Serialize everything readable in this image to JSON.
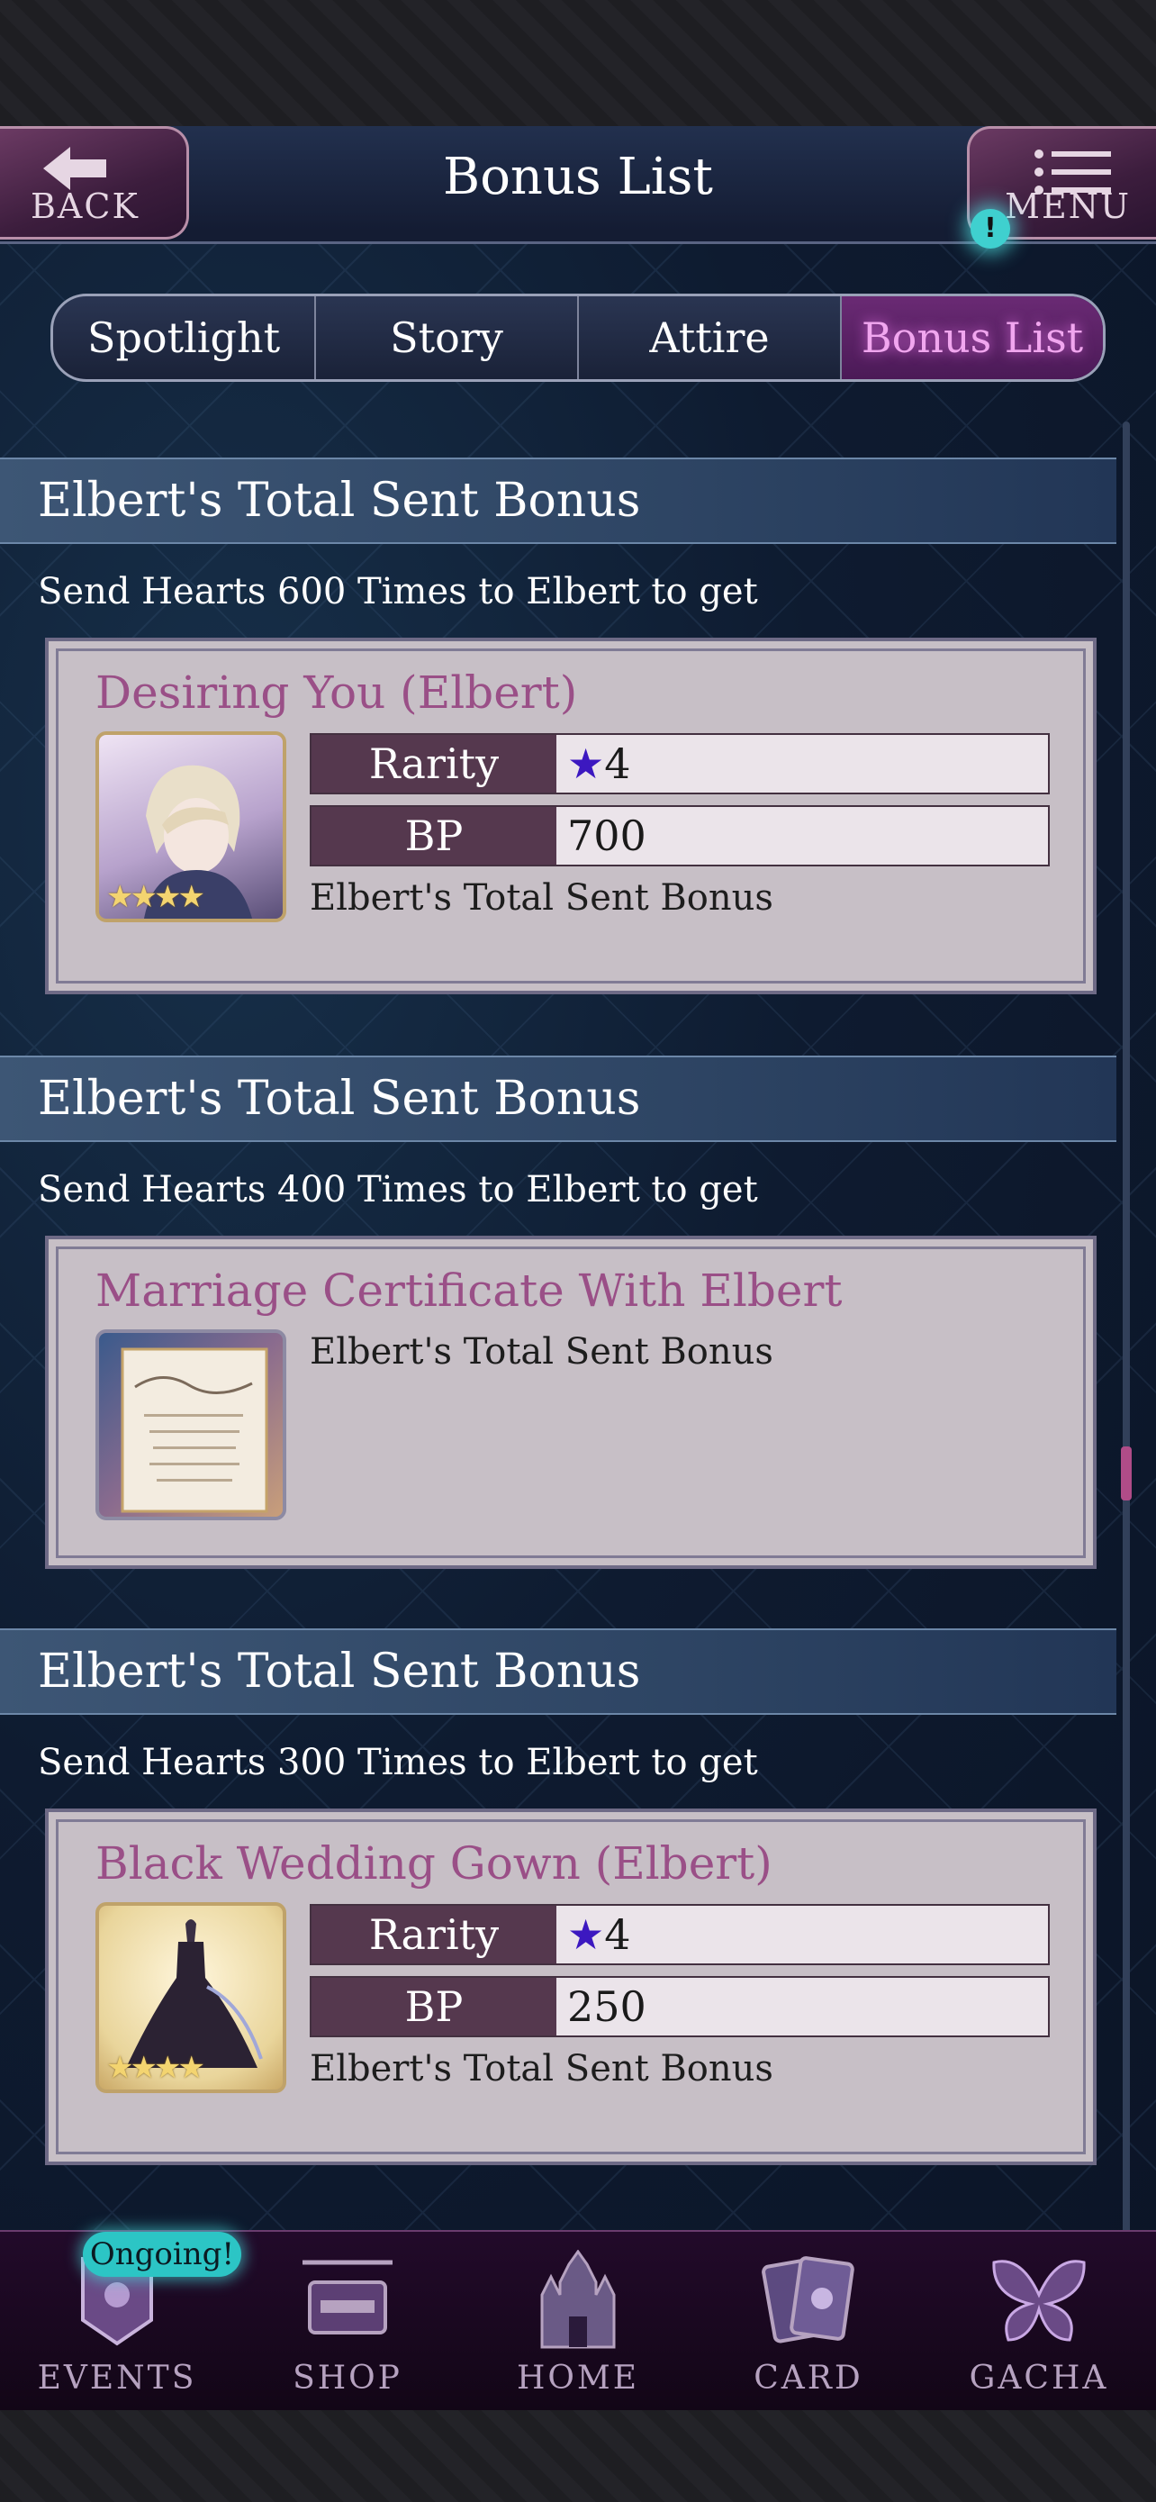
{
  "header": {
    "title": "Bonus List",
    "back_label": "BACK",
    "menu_label": "MENU",
    "notification_mark": "!"
  },
  "tabs": [
    {
      "label": "Spotlight",
      "active": false
    },
    {
      "label": "Story",
      "active": false
    },
    {
      "label": "Attire",
      "active": false
    },
    {
      "label": "Bonus List",
      "active": true
    }
  ],
  "sections": [
    {
      "title": "Elbert's Total Sent Bonus",
      "subtitle": "Send Hearts 600 Times to Elbert to get",
      "item": {
        "name": "Desiring You (Elbert)",
        "rarity_label": "Rarity",
        "rarity_star": "★",
        "rarity_value": "4",
        "bp_label": "BP",
        "bp_value": "700",
        "bonus_text": "Elbert's Total Sent Bonus",
        "star_count": 4
      }
    },
    {
      "title": "Elbert's Total Sent Bonus",
      "subtitle": "Send Hearts 400 Times to Elbert to get",
      "item": {
        "name": "Marriage Certificate With Elbert",
        "bonus_text": "Elbert's Total Sent Bonus"
      }
    },
    {
      "title": "Elbert's Total Sent Bonus",
      "subtitle": "Send Hearts 300 Times to Elbert to get",
      "item": {
        "name": "Black Wedding Gown (Elbert)",
        "rarity_label": "Rarity",
        "rarity_star": "★",
        "rarity_value": "4",
        "bp_label": "BP",
        "bp_value": "250",
        "bonus_text": "Elbert's Total Sent Bonus",
        "star_count": 4
      }
    }
  ],
  "nav": {
    "ongoing_badge": "Ongoing!",
    "items": [
      {
        "label": "EVENTS",
        "icon": "events-icon"
      },
      {
        "label": "SHOP",
        "icon": "shop-icon"
      },
      {
        "label": "HOME",
        "icon": "castle-icon"
      },
      {
        "label": "CARD",
        "icon": "card-icon"
      },
      {
        "label": "GACHA",
        "icon": "butterfly-icon"
      }
    ]
  },
  "colors": {
    "accent_pink": "#f1a6ef",
    "card_title": "#9a4f87",
    "rarity_star": "#3c18c0",
    "ongoing": "#2cc5c5"
  }
}
